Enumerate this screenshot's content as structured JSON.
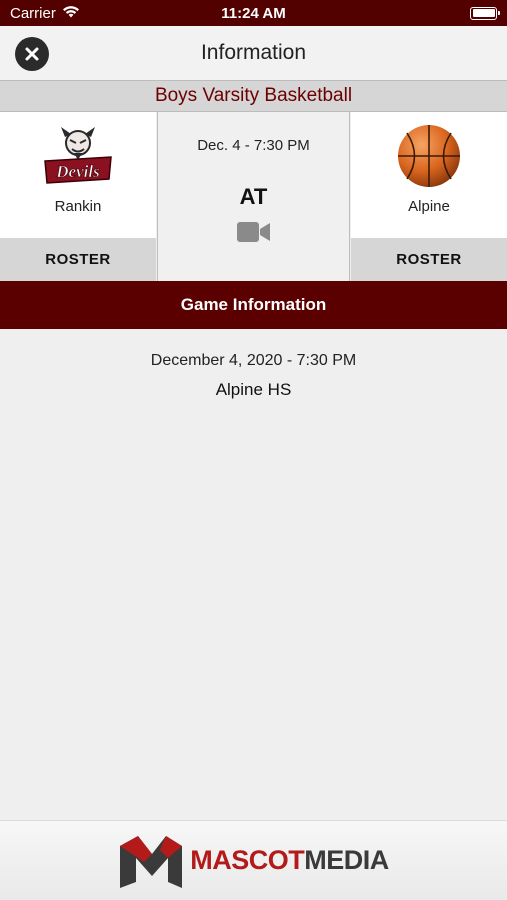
{
  "status_bar": {
    "carrier": "Carrier",
    "time": "11:24 AM"
  },
  "header": {
    "title": "Information"
  },
  "sport": "Boys Varsity Basketball",
  "matchup": {
    "home": {
      "name": "Rankin",
      "roster_label": "ROSTER"
    },
    "away": {
      "name": "Alpine",
      "roster_label": "ROSTER"
    },
    "datetime_short": "Dec. 4 - 7:30 PM",
    "connector": "AT"
  },
  "game_info": {
    "header": "Game Information",
    "datetime": "December 4, 2020 - 7:30 PM",
    "location": "Alpine HS"
  },
  "footer": {
    "brand_part1": "MASCOT",
    "brand_part2": "MEDIA"
  },
  "colors": {
    "primary": "#5a0000",
    "accent": "#6b0000",
    "brand_red": "#b31b1b"
  }
}
